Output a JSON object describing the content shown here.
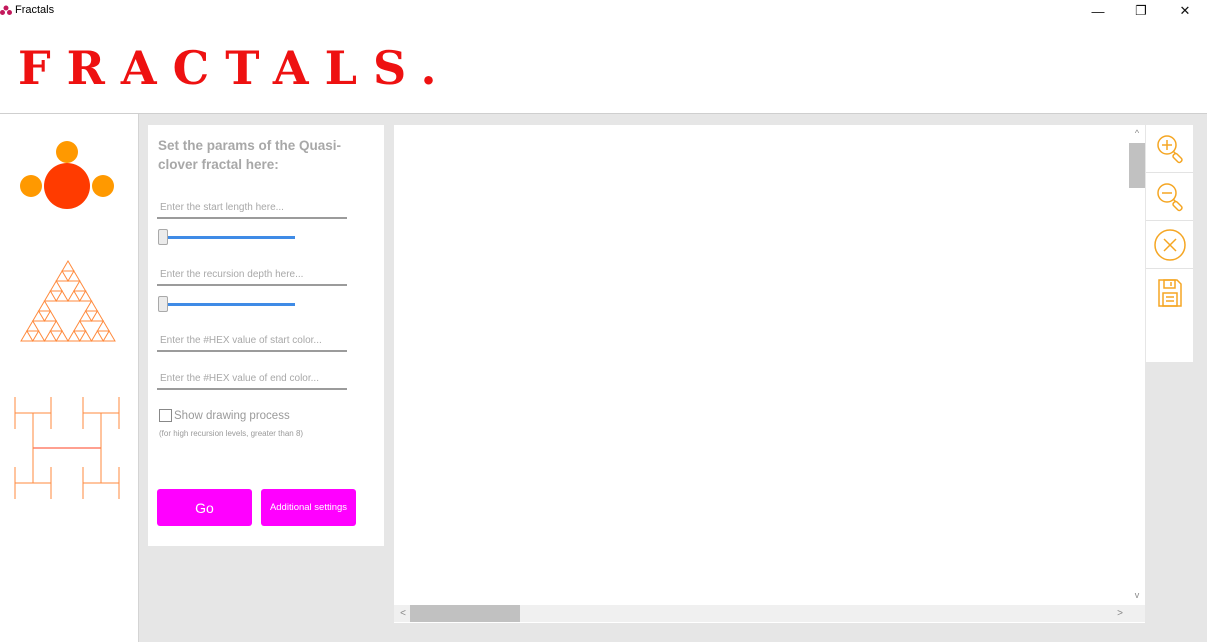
{
  "window": {
    "title": "Fractals",
    "minimize_glyph": "—",
    "maximize_glyph": "❐",
    "close_glyph": "✕",
    "icon": "fractal-app-icon"
  },
  "header": {
    "brand": "FRACTALS."
  },
  "sidebar": {
    "items": [
      {
        "name": "quasi-clover",
        "icon": "quasi-clover-icon",
        "colors": [
          "#ff3b00",
          "#ff9900"
        ]
      },
      {
        "name": "sierpinski-triangle",
        "icon": "sierpinski-triangle-icon",
        "colors": [
          "#ff8a3d"
        ]
      },
      {
        "name": "h-tree",
        "icon": "h-tree-icon",
        "colors": [
          "#ff8a3d",
          "#ff4020"
        ]
      }
    ]
  },
  "params": {
    "title": "Set the params of the Quasi-clover fractal here:",
    "start_length_placeholder": "Enter the start length here...",
    "start_length_level": 0,
    "recursion_depth_placeholder": "Enter the recursion depth here...",
    "recursion_depth_level": 0,
    "start_color_placeholder": "Enter the #HEX value of start color...",
    "end_color_placeholder": "Enter the #HEX value of end color...",
    "show_drawing_label": "Show drawing process",
    "show_drawing_checked": false,
    "hint": "(for high recursion levels, greater than 8)",
    "go_label": "Go",
    "additional_label": "Additional settings"
  },
  "scrollbars": {
    "up": "^",
    "down": "v",
    "left": "<",
    "right": ">"
  },
  "toolbar": {
    "items": [
      {
        "name": "zoom-in",
        "icon": "zoom-in-icon"
      },
      {
        "name": "zoom-out",
        "icon": "zoom-out-icon"
      },
      {
        "name": "clear",
        "icon": "close-circle-icon"
      },
      {
        "name": "save",
        "icon": "save-icon"
      }
    ]
  },
  "colors": {
    "brand": "#ee1111",
    "accent_button": "#ff00ff",
    "slider": "#3f8be6",
    "tool_icons": "#f5a623",
    "background": "#e6e6e6"
  }
}
